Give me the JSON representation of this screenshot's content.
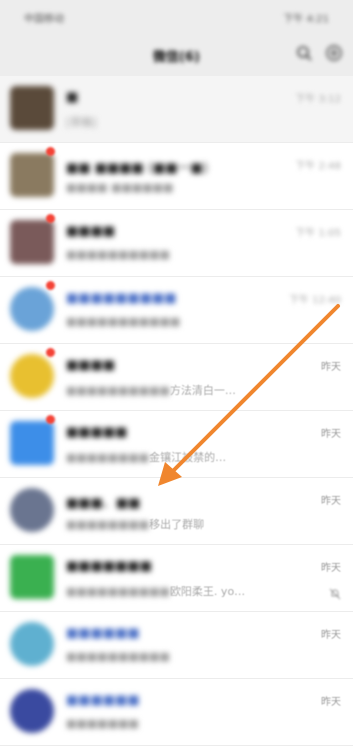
{
  "status_bar": {
    "carrier": "中国移动",
    "time": "下午 4:21"
  },
  "header": {
    "title": "微信(6)"
  },
  "chats": [
    {
      "name": "■",
      "preview_blurred": "[草稿] ",
      "preview_clear": "",
      "time": "下午 3:12",
      "avatar_color": "#5a4a3a",
      "pinned": true,
      "badge": false
    },
    {
      "name": "■■ ■■■■ (■■一■)",
      "preview_blurred": "■■■■ ■■■■■■",
      "preview_clear": "",
      "time": "下午 2:48",
      "avatar_color": "#8a7a60",
      "pinned": false,
      "badge": true
    },
    {
      "name": "■■■■",
      "preview_blurred": "■■■■■■■■■■",
      "preview_clear": "",
      "time": "下午 1:05",
      "avatar_color": "#7a5a5a",
      "pinned": false,
      "badge": true
    },
    {
      "name": "■■■■■■■■■",
      "preview_blurred": "■■■■■■■■■■■",
      "preview_clear": "",
      "time": "下午 12:40",
      "avatar_color": "#6aa3d8",
      "pinned": false,
      "badge": true
    },
    {
      "name": "■■■■",
      "preview_blurred": "■■■■■■■■■■",
      "preview_clear": "方法清白一…",
      "time": "昨天",
      "avatar_color": "#e8c030",
      "pinned": false,
      "badge": true
    },
    {
      "name": "■■■■■",
      "preview_blurred": "■■■■■■■■",
      "preview_clear": "金镶江被禁的…",
      "time": "昨天",
      "avatar_color": "#3d8ee8",
      "pinned": false,
      "badge": true
    },
    {
      "name": "■■■、■■",
      "preview_blurred": "■■■■■■■■",
      "preview_clear": "移出了群聊",
      "time": "昨天",
      "avatar_color": "#6a7590",
      "pinned": false,
      "badge": false
    },
    {
      "name": "■■■■■■■",
      "preview_blurred": "■■■■■■■■■■",
      "preview_clear": "欧阳柔王. yo…",
      "time": "昨天",
      "avatar_color": "#3ab050",
      "pinned": false,
      "badge": false,
      "muted": true
    },
    {
      "name": "■■■■■■",
      "preview_blurred": "■■■■■■■■■■",
      "preview_clear": "",
      "time": "昨天",
      "avatar_color": "#5fb0d0",
      "pinned": false,
      "badge": false
    },
    {
      "name": "■■■■■■",
      "preview_blurred": "■■■■■■■",
      "preview_clear": "",
      "time": "昨天",
      "avatar_color": "#3a4aa0",
      "pinned": false,
      "badge": false
    }
  ],
  "colors": {
    "arrow": "#f0862e",
    "badge": "#f44336"
  }
}
